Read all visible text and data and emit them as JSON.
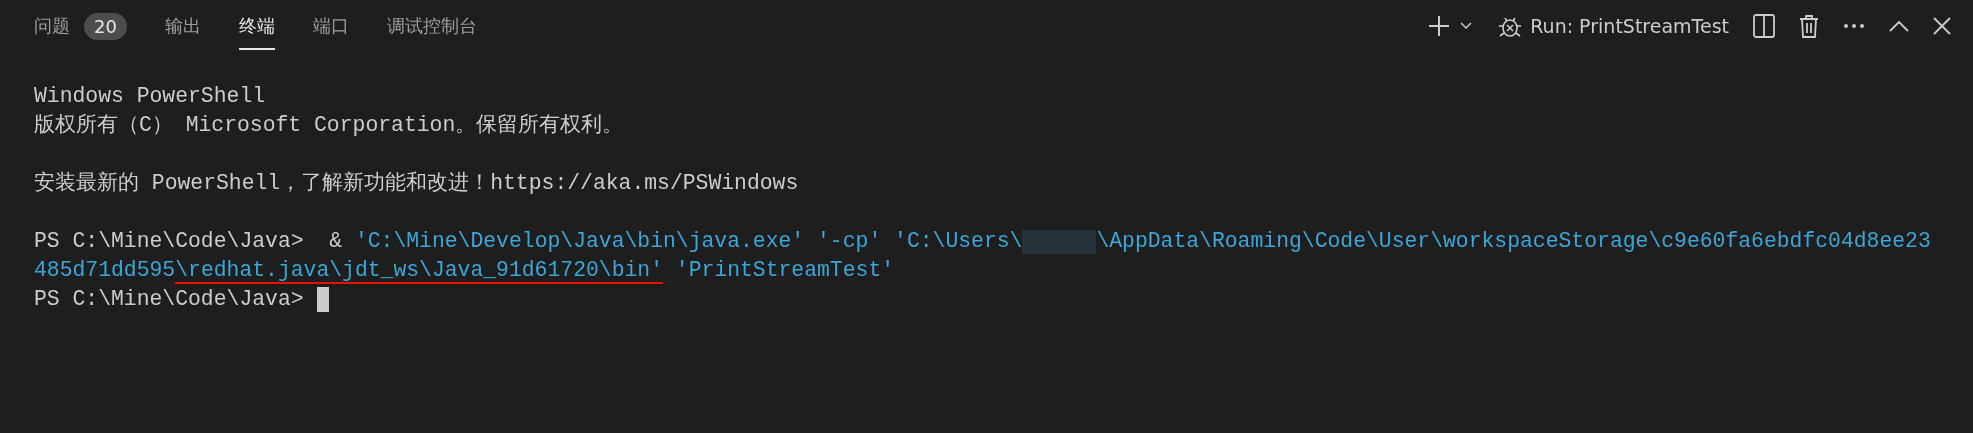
{
  "tabs": [
    {
      "label": "问题",
      "badge": "20",
      "selected": false
    },
    {
      "label": "输出",
      "selected": false
    },
    {
      "label": "终端",
      "selected": true
    },
    {
      "label": "端口",
      "selected": false
    },
    {
      "label": "调试控制台",
      "selected": false
    }
  ],
  "toolbar": {
    "run_label": "Run: PrintStreamTest"
  },
  "terminal": {
    "lines": [
      [
        {
          "kind": "plain",
          "text": "Windows PowerShell"
        }
      ],
      [
        {
          "kind": "plain",
          "text": "版权所有（C） Microsoft Corporation。保留所有权利。"
        }
      ],
      [
        {
          "kind": "blank"
        }
      ],
      [
        {
          "kind": "plain",
          "text": "安装最新的 PowerShell，了解新功能和改进！https://aka.ms/PSWindows"
        }
      ],
      [
        {
          "kind": "blank"
        }
      ],
      [
        {
          "kind": "plain",
          "text": "PS C:\\Mine\\Code\\Java>  & "
        },
        {
          "kind": "string",
          "text": "'C:\\Mine\\Develop\\Java\\bin\\java.exe' '-cp' 'C:\\Users\\"
        },
        {
          "kind": "redacted"
        },
        {
          "kind": "string",
          "text": "\\AppData\\Roaming\\Code\\User\\workspaceStorage\\c9e60fa6ebdfc04d8ee23"
        }
      ],
      [
        {
          "kind": "string",
          "text": "485d71dd595"
        },
        {
          "kind": "underlined",
          "text": "\\redhat.java\\jdt_ws\\Java_91d61720\\bin'"
        },
        {
          "kind": "string",
          "text": " 'PrintStreamTest'"
        }
      ],
      [
        {
          "kind": "plain",
          "text": "PS C:\\Mine\\Code\\Java> "
        },
        {
          "kind": "cursor"
        }
      ]
    ]
  }
}
